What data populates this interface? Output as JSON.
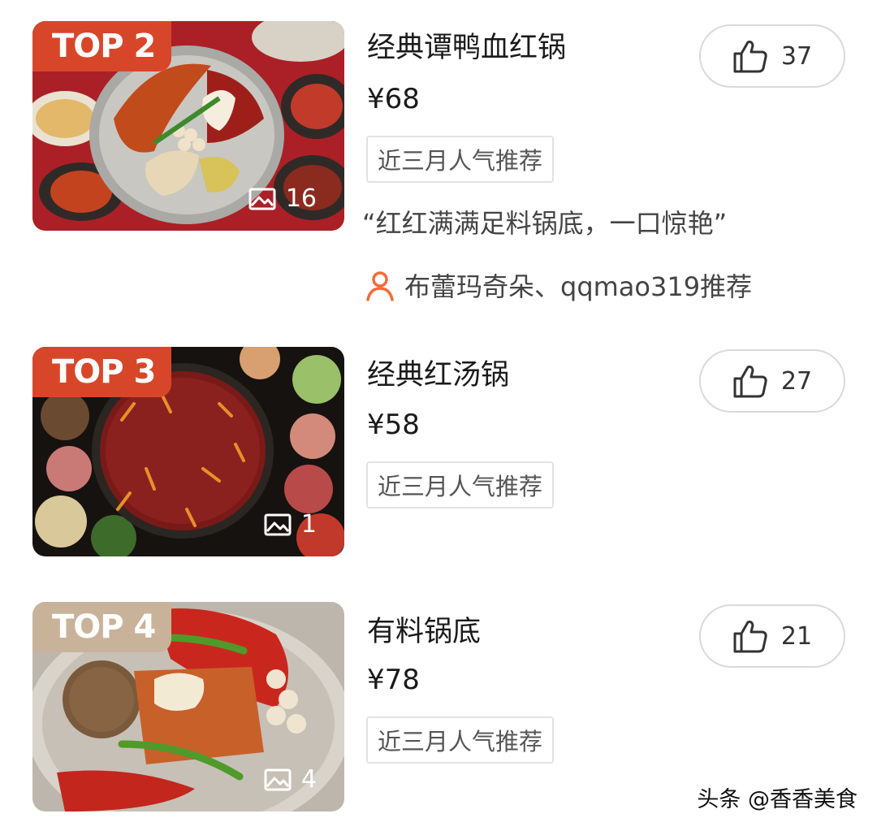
{
  "items": [
    {
      "rank_label": "TOP 2",
      "badge_color": "#d8462a",
      "title": "经典谭鸭血红锅",
      "price": "¥68",
      "tag": "近三月人气推荐",
      "image_count": "16",
      "likes": "37",
      "quote": "“红红满满足料锅底，一口惊艳”",
      "recommenders": "布蕾玛奇朵、qqmao319推荐"
    },
    {
      "rank_label": "TOP 3",
      "badge_color": "#d8462a",
      "title": "经典红汤锅",
      "price": "¥58",
      "tag": "近三月人气推荐",
      "image_count": "1",
      "likes": "27"
    },
    {
      "rank_label": "TOP 4",
      "badge_color": "#c8b39a",
      "title": "有料锅底",
      "price": "¥78",
      "tag": "近三月人气推荐",
      "image_count": "4",
      "likes": "21"
    }
  ],
  "icons": {
    "like": "thumbs-up-icon",
    "images": "image-gallery-icon",
    "user": "user-icon"
  },
  "colors": {
    "accent": "#f26b3a"
  },
  "watermark": "头条 @香香美食"
}
